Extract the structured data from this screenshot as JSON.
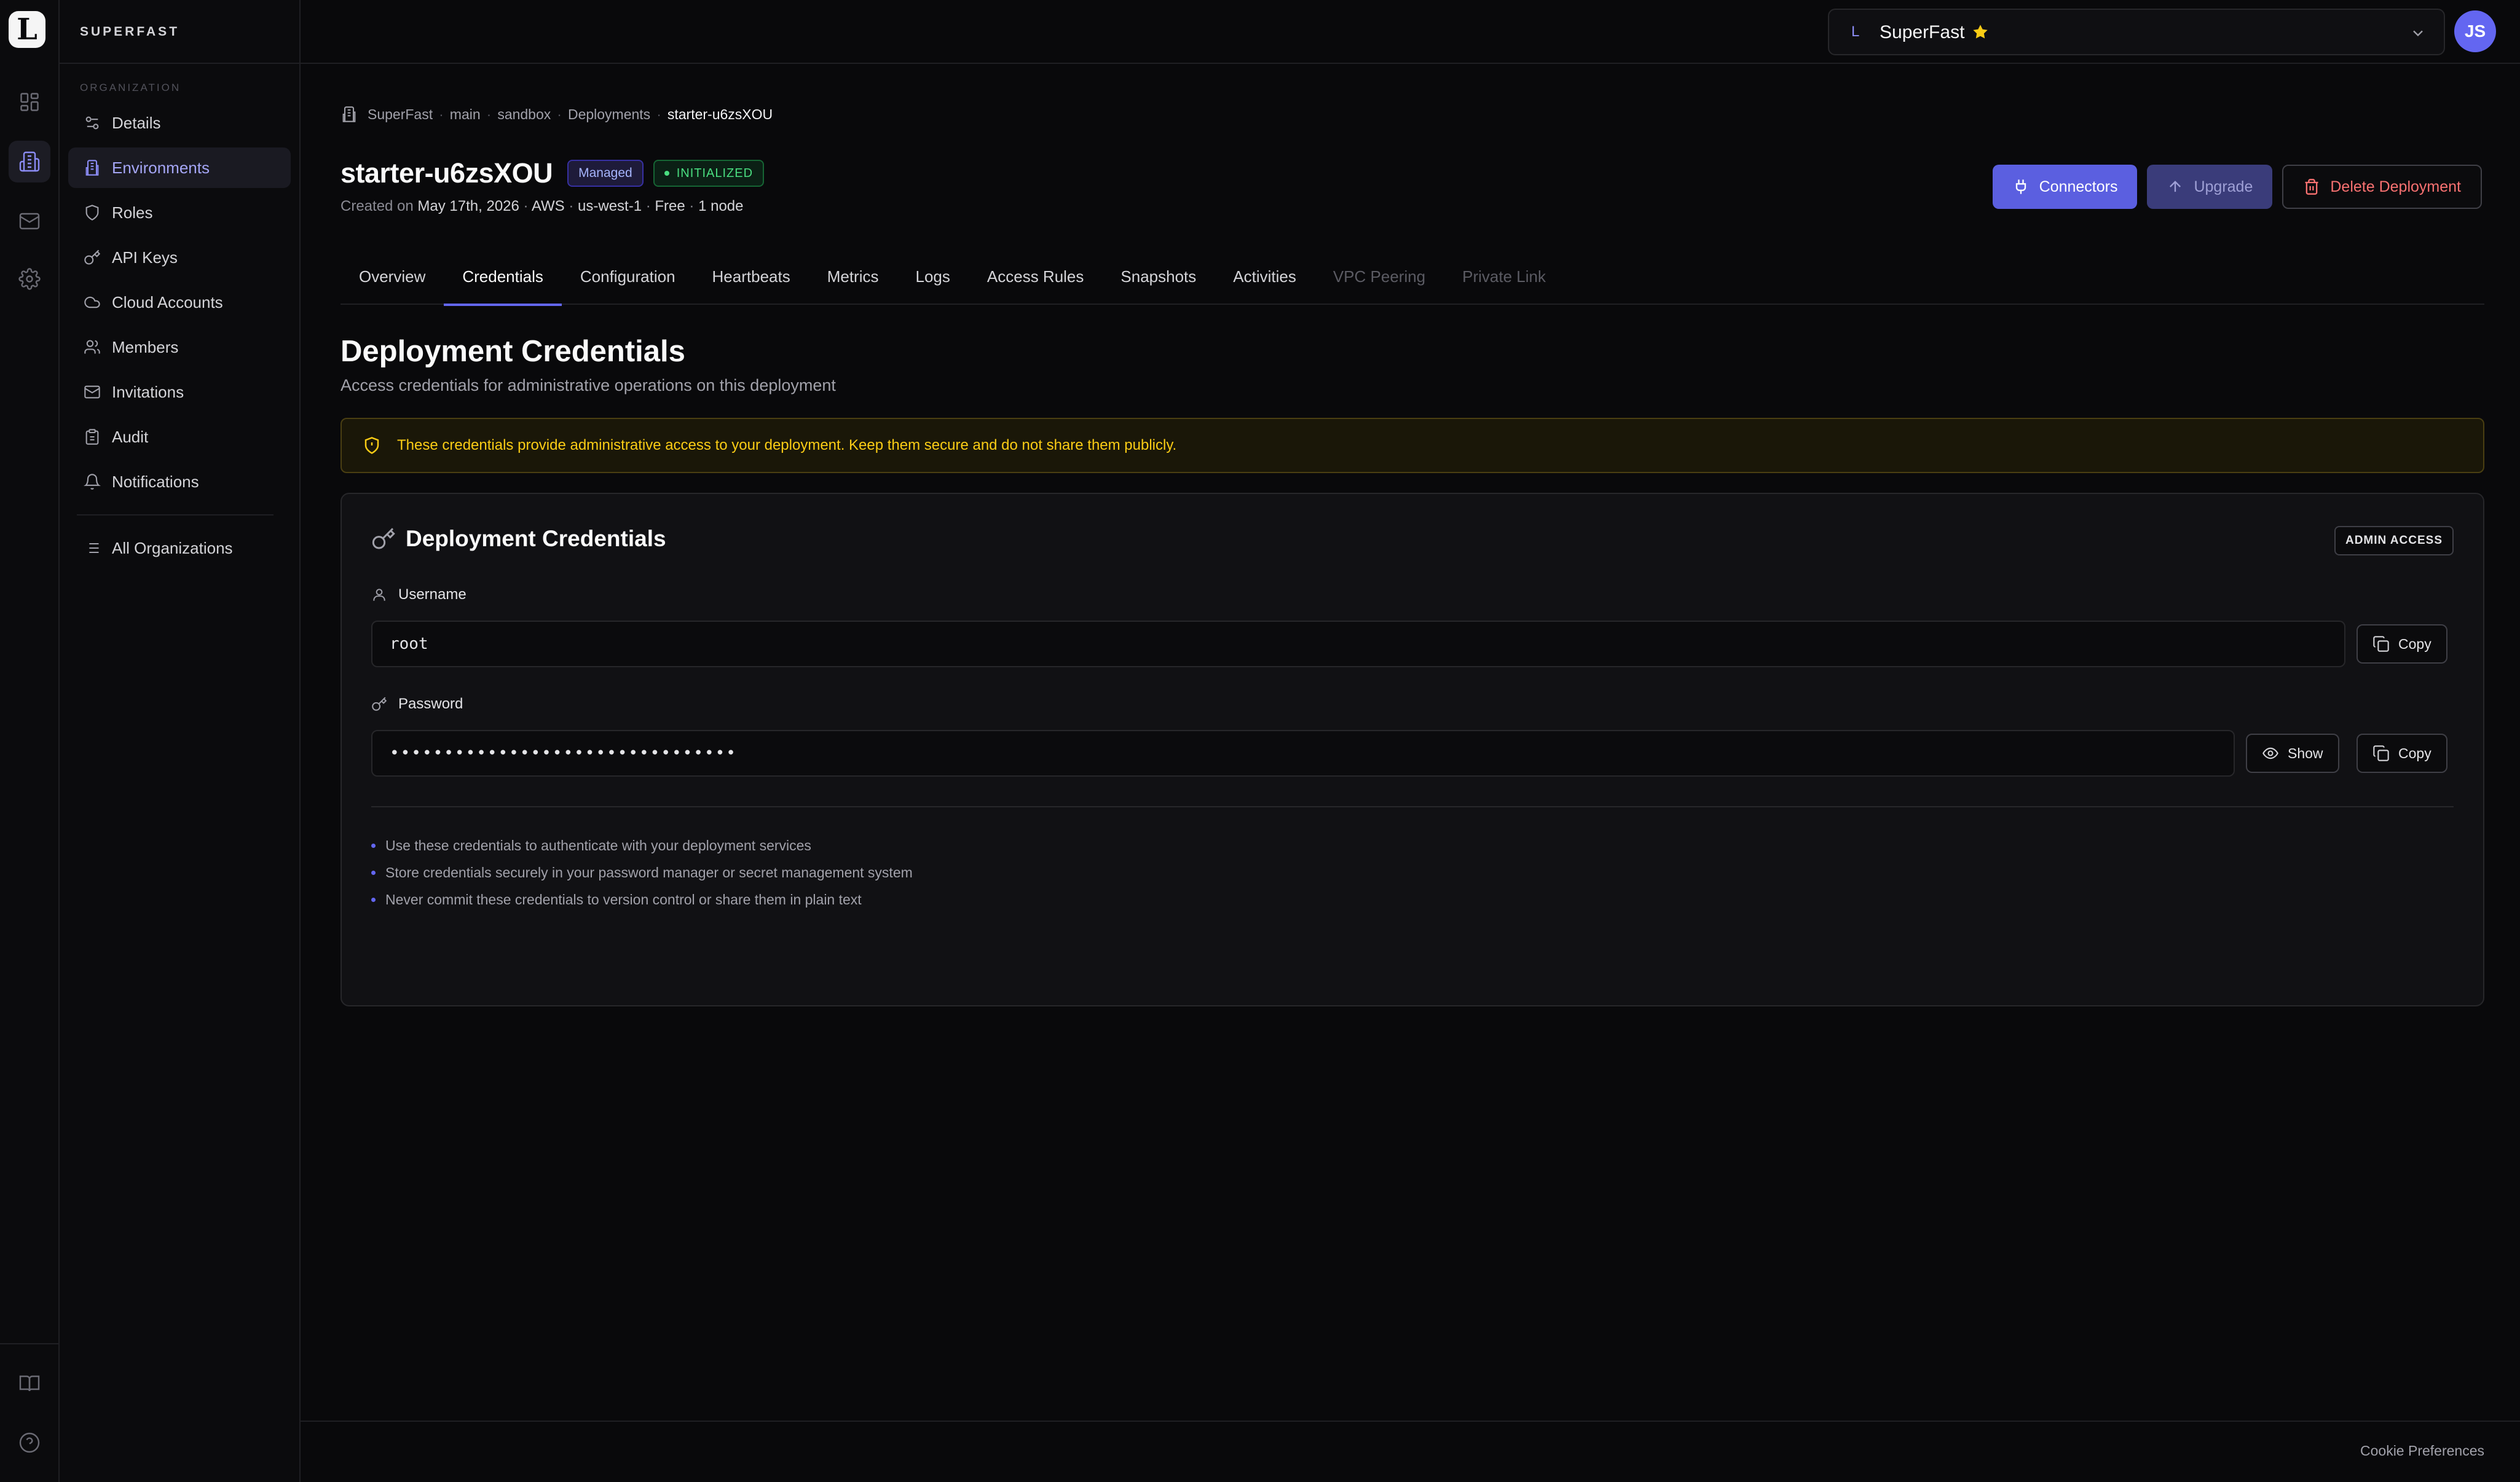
{
  "app": {
    "logo_letter": "L",
    "org_name": "SUPERFAST"
  },
  "sidebar": {
    "section_label": "ORGANIZATION",
    "items": [
      {
        "label": "Details",
        "icon": "sliders-icon",
        "active": false
      },
      {
        "label": "Environments",
        "icon": "building-icon",
        "active": true
      },
      {
        "label": "Roles",
        "icon": "shield-icon",
        "active": false
      },
      {
        "label": "API Keys",
        "icon": "key-icon",
        "active": false
      },
      {
        "label": "Cloud Accounts",
        "icon": "cloud-icon",
        "active": false
      },
      {
        "label": "Members",
        "icon": "users-icon",
        "active": false
      },
      {
        "label": "Invitations",
        "icon": "mail-icon",
        "active": false
      },
      {
        "label": "Audit",
        "icon": "clipboard-icon",
        "active": false
      },
      {
        "label": "Notifications",
        "icon": "bell-icon",
        "active": false
      }
    ],
    "all_orgs_label": "All Organizations"
  },
  "topbar": {
    "org_letter": "L",
    "org_select": "SuperFast",
    "avatar_initials": "JS"
  },
  "breadcrumb": [
    "SuperFast",
    "main",
    "sandbox",
    "Deployments",
    "starter-u6zsXOU"
  ],
  "deployment": {
    "name": "starter-u6zsXOU",
    "managed_badge": "Managed",
    "status_badge": "INITIALIZED",
    "created_prefix": "Created on",
    "created_date": "May 17th, 2026",
    "provider": "AWS",
    "region": "us-west-1",
    "plan": "Free",
    "nodes": "1 node",
    "meta_sep": "·"
  },
  "actions": {
    "connectors": "Connectors",
    "upgrade": "Upgrade",
    "delete": "Delete Deployment"
  },
  "tabs": [
    {
      "label": "Overview",
      "state": "normal"
    },
    {
      "label": "Credentials",
      "state": "active"
    },
    {
      "label": "Configuration",
      "state": "normal"
    },
    {
      "label": "Heartbeats",
      "state": "normal"
    },
    {
      "label": "Metrics",
      "state": "normal"
    },
    {
      "label": "Logs",
      "state": "normal"
    },
    {
      "label": "Access Rules",
      "state": "normal"
    },
    {
      "label": "Snapshots",
      "state": "normal"
    },
    {
      "label": "Activities",
      "state": "normal"
    },
    {
      "label": "VPC Peering",
      "state": "disabled"
    },
    {
      "label": "Private Link",
      "state": "disabled"
    }
  ],
  "page": {
    "title": "Deployment Credentials",
    "subtitle": "Access credentials for administrative operations on this deployment",
    "warning": "These credentials provide administrative access to your deployment. Keep them secure and do not share them publicly."
  },
  "card": {
    "title": "Deployment Credentials",
    "badge": "ADMIN ACCESS",
    "username_label": "Username",
    "username_value": "root",
    "password_label": "Password",
    "password_value": "••••••••••••••••••••••••••••••••",
    "show_label": "Show",
    "copy_label": "Copy",
    "tips": [
      "Use these credentials to authenticate with your deployment services",
      "Store credentials securely in your password manager or secret management system",
      "Never commit these credentials to version control or share them in plain text"
    ]
  },
  "footer": {
    "cookie": "Cookie Preferences"
  },
  "colors": {
    "accent": "#6366f1",
    "success": "#4ade80",
    "warning": "#facc15",
    "danger": "#f87171"
  }
}
